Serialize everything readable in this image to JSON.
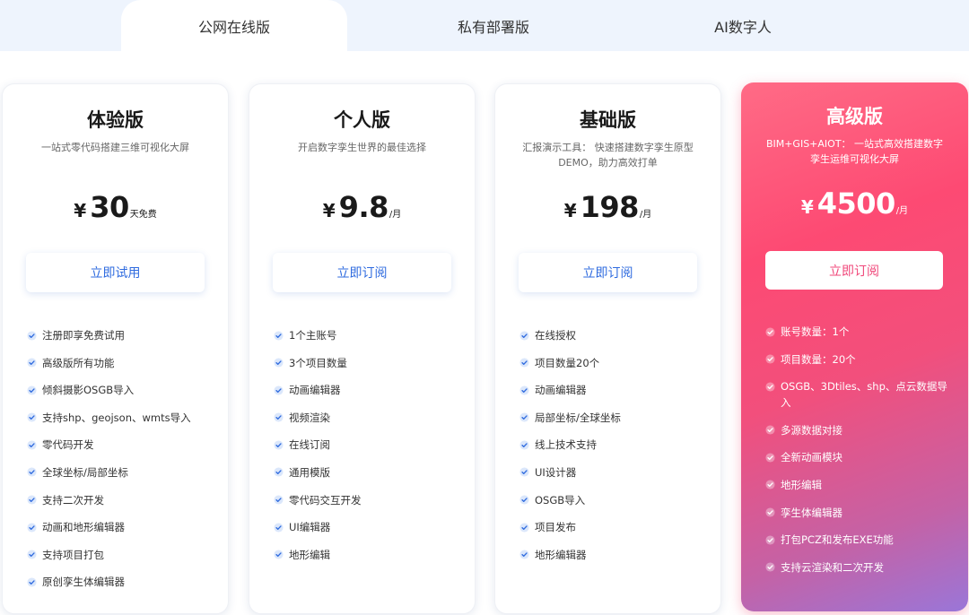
{
  "tabs": [
    {
      "label": "公网在线版",
      "active": true
    },
    {
      "label": "私有部署版",
      "active": false
    },
    {
      "label": "AI数字人",
      "active": false
    }
  ],
  "colors": {
    "accent": "#2f6bdf",
    "tab_bar": "#eef4fd",
    "premium_gradient": [
      "#ff6b86",
      "#fd4a73",
      "#c462a6",
      "#9a76d8"
    ],
    "premium_button_text": "#f0477a"
  },
  "icons": {
    "feature_check": "check-icon"
  },
  "plans": [
    {
      "title": "体验版",
      "desc": "一站式零代码搭建三维可视化大屏",
      "currency": "¥",
      "amount": "30",
      "unit": "天免费",
      "button": "立即试用",
      "features": [
        "注册即享免费试用",
        "高级版所有功能",
        "倾斜摄影OSGB导入",
        "支持shp、geojson、wmts导入",
        "零代码开发",
        "全球坐标/局部坐标",
        "支持二次开发",
        "动画和地形编辑器",
        "支持项目打包",
        "原创孪生体编辑器"
      ]
    },
    {
      "title": "个人版",
      "desc": "开启数字孪生世界的最佳选择",
      "currency": "¥",
      "amount": "9.8",
      "unit": "/月",
      "button": "立即订阅",
      "features": [
        "1个主账号",
        "3个项目数量",
        "动画编辑器",
        "视频渲染",
        "在线订阅",
        "通用模版",
        "零代码交互开发",
        "UI编辑器",
        "地形编辑"
      ]
    },
    {
      "title": "基础版",
      "desc": "汇报演示工具： 快速搭建数字孪生原型DEMO，助力高效打单",
      "currency": "¥",
      "amount": "198",
      "unit": "/月",
      "button": "立即订阅",
      "features": [
        "在线授权",
        "项目数量20个",
        "动画编辑器",
        "局部坐标/全球坐标",
        "线上技术支持",
        "UI设计器",
        "OSGB导入",
        "项目发布",
        "地形编辑器"
      ]
    },
    {
      "title": "高级版",
      "desc": "BIM+GIS+AIOT： 一站式高效搭建数字孪生运维可视化大屏",
      "currency": "¥",
      "amount": "4500",
      "unit": "/月",
      "button": "立即订阅",
      "features": [
        "账号数量：1个",
        "项目数量：20个",
        "OSGB、3Dtiles、shp、点云数据导入",
        "多源数据对接",
        "全新动画模块",
        "地形编辑",
        "孪生体编辑器",
        "打包PCZ和发布EXE功能",
        "支持云渲染和二次开发"
      ]
    }
  ]
}
